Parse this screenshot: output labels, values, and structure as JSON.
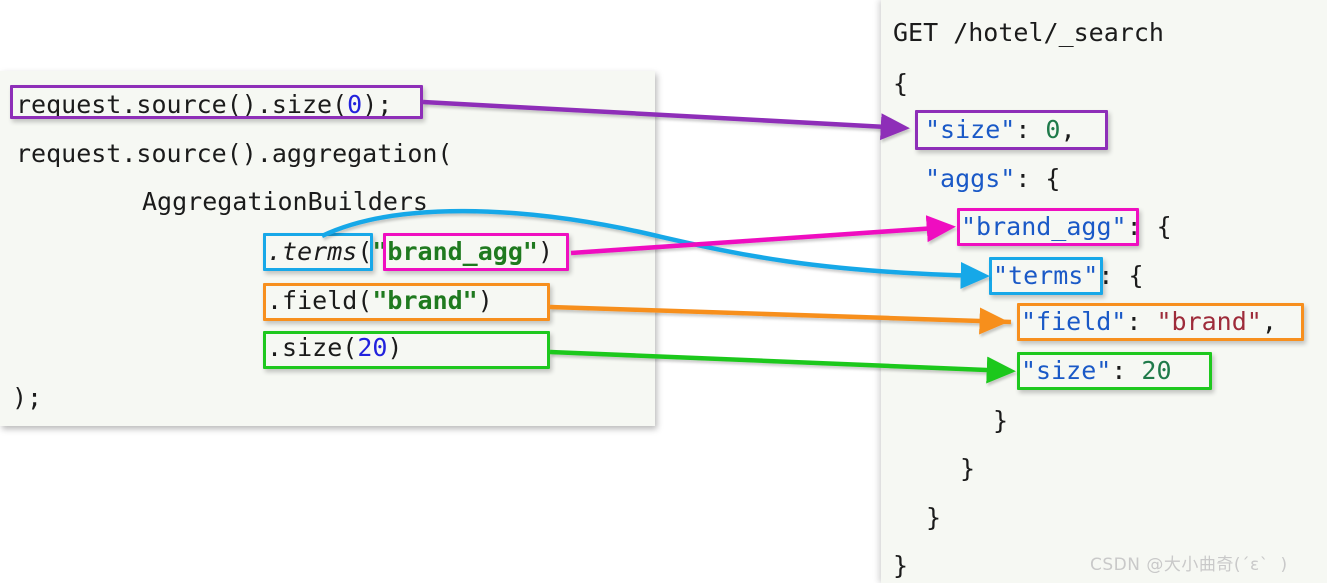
{
  "colors": {
    "purple": "#8e2fb8",
    "magenta": "#ef0fc0",
    "blue": "#18a8e8",
    "orange": "#f78f1e",
    "green": "#1ec81e",
    "panel_bg": "#f6f8f3",
    "page_bg": "#ffffff",
    "json_key": "#1a59c7",
    "json_string": "#9e2b3a",
    "json_number": "#1f7a4a",
    "java_string": "#1f7a1f",
    "java_number": "#2222dd"
  },
  "java_panel": {
    "lines": [
      {
        "id": "line-size",
        "indent": 0,
        "segments": [
          {
            "text": "request.source().size(",
            "cls": "plain"
          },
          {
            "text": "0",
            "cls": "num"
          },
          {
            "text": ");",
            "cls": "plain"
          }
        ]
      },
      {
        "id": "line-aggregation",
        "indent": 0,
        "segments": [
          {
            "text": "request.source().aggregation(",
            "cls": "plain"
          }
        ]
      },
      {
        "id": "line-builders",
        "indent": 5,
        "segments": [
          {
            "text": "AggregationBuilders",
            "cls": "plain"
          }
        ]
      },
      {
        "id": "line-terms",
        "indent": 10,
        "segments": [
          {
            "text": ".terms",
            "cls": "ital"
          },
          {
            "text": "(",
            "cls": "plain"
          },
          {
            "text": "\"brand_agg\"",
            "cls": "str"
          },
          {
            "text": ")",
            "cls": "plain"
          }
        ]
      },
      {
        "id": "line-field",
        "indent": 10,
        "segments": [
          {
            "text": ".field(",
            "cls": "plain"
          },
          {
            "text": "\"brand\"",
            "cls": "str"
          },
          {
            "text": ")",
            "cls": "plain"
          }
        ]
      },
      {
        "id": "line-dsize",
        "indent": 10,
        "segments": [
          {
            "text": ".size(",
            "cls": "plain"
          },
          {
            "text": "20",
            "cls": "num"
          },
          {
            "text": ")",
            "cls": "plain"
          }
        ]
      },
      {
        "id": "line-close",
        "indent": 0,
        "segments": [
          {
            "text": ");",
            "cls": "plain"
          }
        ]
      }
    ]
  },
  "json_panel": {
    "request_line": "GET /hotel/_search",
    "lines": [
      {
        "id": "json-open",
        "text": "{"
      },
      {
        "id": "json-size",
        "text": "  \"size\": 0,"
      },
      {
        "id": "json-aggs",
        "text": "  \"aggs\": {"
      },
      {
        "id": "json-brandagg",
        "text": "    \"brand_agg\": {"
      },
      {
        "id": "json-terms",
        "text": "      \"terms\": {"
      },
      {
        "id": "json-field",
        "text": "        \"field\": \"brand\","
      },
      {
        "id": "json-size20",
        "text": "        \"size\": 20"
      },
      {
        "id": "json-close1",
        "text": "      }"
      },
      {
        "id": "json-close2",
        "text": "    }"
      },
      {
        "id": "json-close3",
        "text": "  }"
      },
      {
        "id": "json-close4",
        "text": "}"
      }
    ],
    "tokens": {
      "size_key": "\"size\"",
      "size_value": "0",
      "aggs_key": "\"aggs\"",
      "brand_agg_key": "\"brand_agg\"",
      "terms_key": "\"terms\"",
      "field_key": "\"field\"",
      "field_value": "\"brand\"",
      "size2_key": "\"size\"",
      "size2_value": "20",
      "colon": ":",
      "comma": ",",
      "brace_open": "{",
      "brace_close": "}"
    }
  },
  "mappings": [
    {
      "id": "map-size",
      "color": "#8e2fb8",
      "left_label": "request.source().size(0);",
      "right_label": "\"size\": 0,"
    },
    {
      "id": "map-terms",
      "color": "#18a8e8",
      "left_label": ".terms",
      "right_label": "\"terms\""
    },
    {
      "id": "map-brandagg",
      "color": "#ef0fc0",
      "left_label": "\"brand_agg\"",
      "right_label": "\"brand_agg\""
    },
    {
      "id": "map-field",
      "color": "#f78f1e",
      "left_label": ".field(\"brand\")",
      "right_label": "\"field\": \"brand\","
    },
    {
      "id": "map-size20",
      "color": "#1ec81e",
      "left_label": ".size(20)",
      "right_label": "\"size\": 20"
    }
  ],
  "watermark": {
    "text": "CSDN @大小曲奇(´ε`  )"
  }
}
